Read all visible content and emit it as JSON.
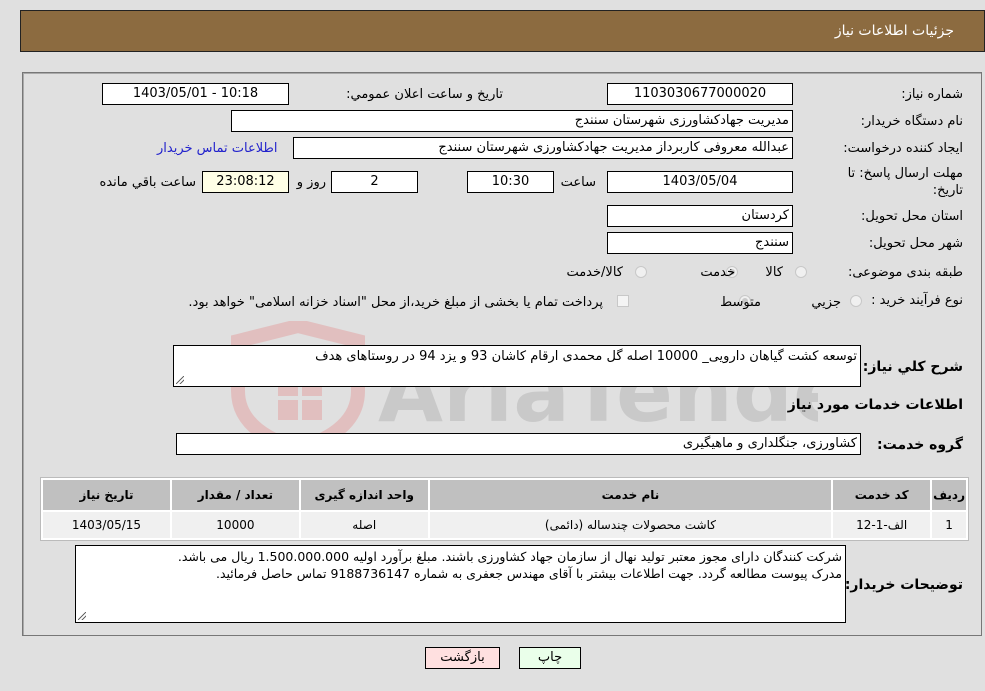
{
  "header": {
    "title": "جزئیات اطلاعات نیاز"
  },
  "form": {
    "need_number": {
      "label": "شماره نیاز:",
      "value": "1103030677000020"
    },
    "announce_datetime": {
      "label": "تاریخ و ساعت اعلان عمومي:",
      "value": "1403/05/01 - 10:18"
    },
    "buyer_org": {
      "label": "نام دستگاه خريدار:",
      "value": "مدیریت جهادکشاورزی شهرستان سنندج"
    },
    "requester": {
      "label": "ايجاد کننده درخواست:",
      "value": "عبدالله معروفی کاربرداز مدیریت جهادکشاورزی شهرستان سنندج"
    },
    "buyer_contact_link": "اطلاعات تماس خریدار",
    "deadline": {
      "label": "مهلت ارسال پاسخ: تا تاریخ:",
      "date": "1403/05/04",
      "time_label": "ساعت",
      "time": "10:30",
      "days": "2",
      "days_label": "روز و",
      "remaining": "23:08:12",
      "remaining_label": "ساعت باقي مانده"
    },
    "province": {
      "label": "استان محل تحويل:",
      "value": "کردستان"
    },
    "city": {
      "label": "شهر محل تحويل:",
      "value": "سنندج"
    },
    "category": {
      "label": "طبقه بندی موضوعی:",
      "options": [
        "کالا",
        "خدمت",
        "کالا/خدمت"
      ],
      "selected": "خدمت"
    },
    "purchase_type": {
      "label": "نوع فرآيند خريد :",
      "options": [
        "جزيي",
        "متوسط"
      ],
      "selected": "متوسط",
      "treasury_note": "پرداخت تمام یا بخشی از مبلغ خرید،از محل \"اسناد خزانه اسلامی\" خواهد بود."
    },
    "description": {
      "label": "شرح کلي نياز:",
      "value": "توسعه کشت گیاهان دارویی_ 10000 اصله گل محمدی ارقام کاشان 93 و یزد 94 در روستاهای هدف"
    },
    "services_section_title": "اطلاعات خدمات مورد نياز",
    "service_group": {
      "label": "گروه خدمت:",
      "value": "کشاورزی، جنگلداری و ماهیگیری"
    }
  },
  "table": {
    "headers": [
      "رديف",
      "کد خدمت",
      "نام خدمت",
      "واحد اندازه گيری",
      "تعداد / مقدار",
      "تاريخ نياز"
    ],
    "rows": [
      [
        "1",
        "الف-1-12",
        "کاشت محصولات چندساله (دائمی)",
        "اصله",
        "10000",
        "1403/05/15"
      ]
    ]
  },
  "buyer_notes": {
    "label": "توضيحات خريدار:",
    "lines": [
      "شرکت کنندگان دارای مجوز معتبر تولید نهال از سازمان جهاد کشاورزی باشند. مبلغ برآورد اولیه 1.500.000.000 ریال می باشد.",
      "مدرک پیوست مطالعه گردد. جهت اطلاعات بیشتر با آقای مهندس جعفری به شماره 9188736147 تماس حاصل فرمائید."
    ]
  },
  "buttons": {
    "print": "چاپ",
    "back": "بازگشت"
  },
  "watermark": "AriaTender.neT",
  "colors": {
    "header_bg": "#8c6b40",
    "print_bg": "#eaffea",
    "back_bg": "#ffe0e0",
    "link": "#2222cc"
  }
}
